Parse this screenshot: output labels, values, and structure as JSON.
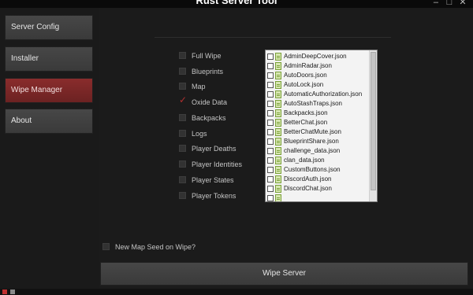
{
  "window": {
    "title": "Rust Server Tool",
    "minimize_symbol": "–",
    "maximize_symbol": "□",
    "close_symbol": "✕"
  },
  "sidebar": {
    "items": [
      {
        "label": "Server Config",
        "active": false
      },
      {
        "label": "Installer",
        "active": false
      },
      {
        "label": "Wipe Manager",
        "active": true
      },
      {
        "label": "About",
        "active": false
      }
    ]
  },
  "wipe_options": [
    {
      "label": "Full Wipe",
      "checked": false
    },
    {
      "label": "Blueprints",
      "checked": false
    },
    {
      "label": "Map",
      "checked": false
    },
    {
      "label": "Oxide Data",
      "checked": true
    },
    {
      "label": "Backpacks",
      "checked": false
    },
    {
      "label": "Logs",
      "checked": false
    },
    {
      "label": "Player Deaths",
      "checked": false
    },
    {
      "label": "Player Identities",
      "checked": false
    },
    {
      "label": "Player States",
      "checked": false
    },
    {
      "label": "Player Tokens",
      "checked": false
    }
  ],
  "check_mark": "✓",
  "file_list": [
    "AdminDeepCover.json",
    "AdminRadar.json",
    "AutoDoors.json",
    "AutoLock.json",
    "AutomaticAuthorization.json",
    "AutoStashTraps.json",
    "Backpacks.json",
    "BetterChat.json",
    "BetterChatMute.json",
    "BlueprintShare.json",
    "challenge_data.json",
    "clan_data.json",
    "CustomButtons.json",
    "DiscordAuth.json",
    "DiscordChat.json"
  ],
  "new_map_seed": {
    "label": "New Map Seed on Wipe?",
    "checked": false
  },
  "wipe_button_label": "Wipe Server",
  "colors": {
    "accent": "#7a2626",
    "background": "#1b1b1b",
    "button": "#3f3f3f"
  }
}
